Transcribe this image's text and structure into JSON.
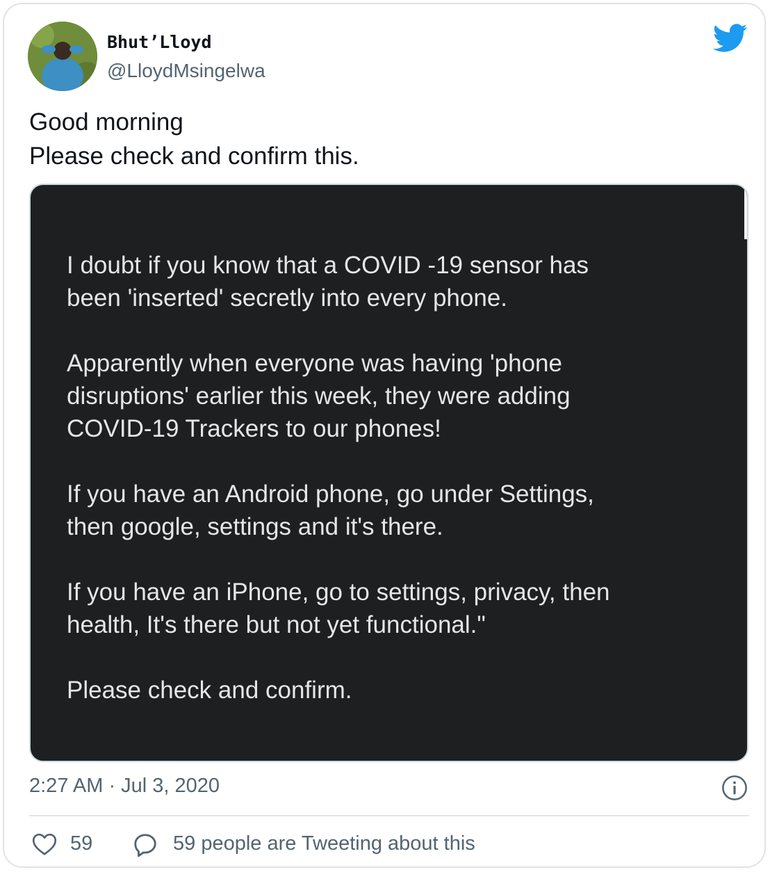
{
  "author": {
    "display_name": "Bhut’Lloyd",
    "handle": "@LloydMsingelwa"
  },
  "icons": {
    "logo": "twitter-bird-icon",
    "info": "info-icon",
    "like": "heart-icon",
    "reply": "speech-bubble-icon"
  },
  "colors": {
    "twitter_blue": "#1d9bf0",
    "media_background": "#1d1f21",
    "secondary_text": "#536471"
  },
  "tweet": {
    "line1": "Good morning",
    "line2": "Please check and confirm this."
  },
  "media": {
    "paragraphs": [
      "I doubt if you know that a COVID -19 sensor has\nbeen 'inserted' secretly into every phone.",
      "Apparently when everyone was having 'phone\ndisruptions' earlier this week, they were adding\nCOVID-19 Trackers to our phones!",
      "If you have an Android phone, go under Settings,\nthen google, settings and it's there.",
      "If you have an iPhone, go to settings, privacy, then\nhealth, It's there but not yet functional.\"",
      "Please check and confirm."
    ]
  },
  "timestamp": "2:27 AM · Jul 3, 2020",
  "engagement": {
    "likes": "59",
    "tweeting_about": "59 people are Tweeting about this"
  }
}
